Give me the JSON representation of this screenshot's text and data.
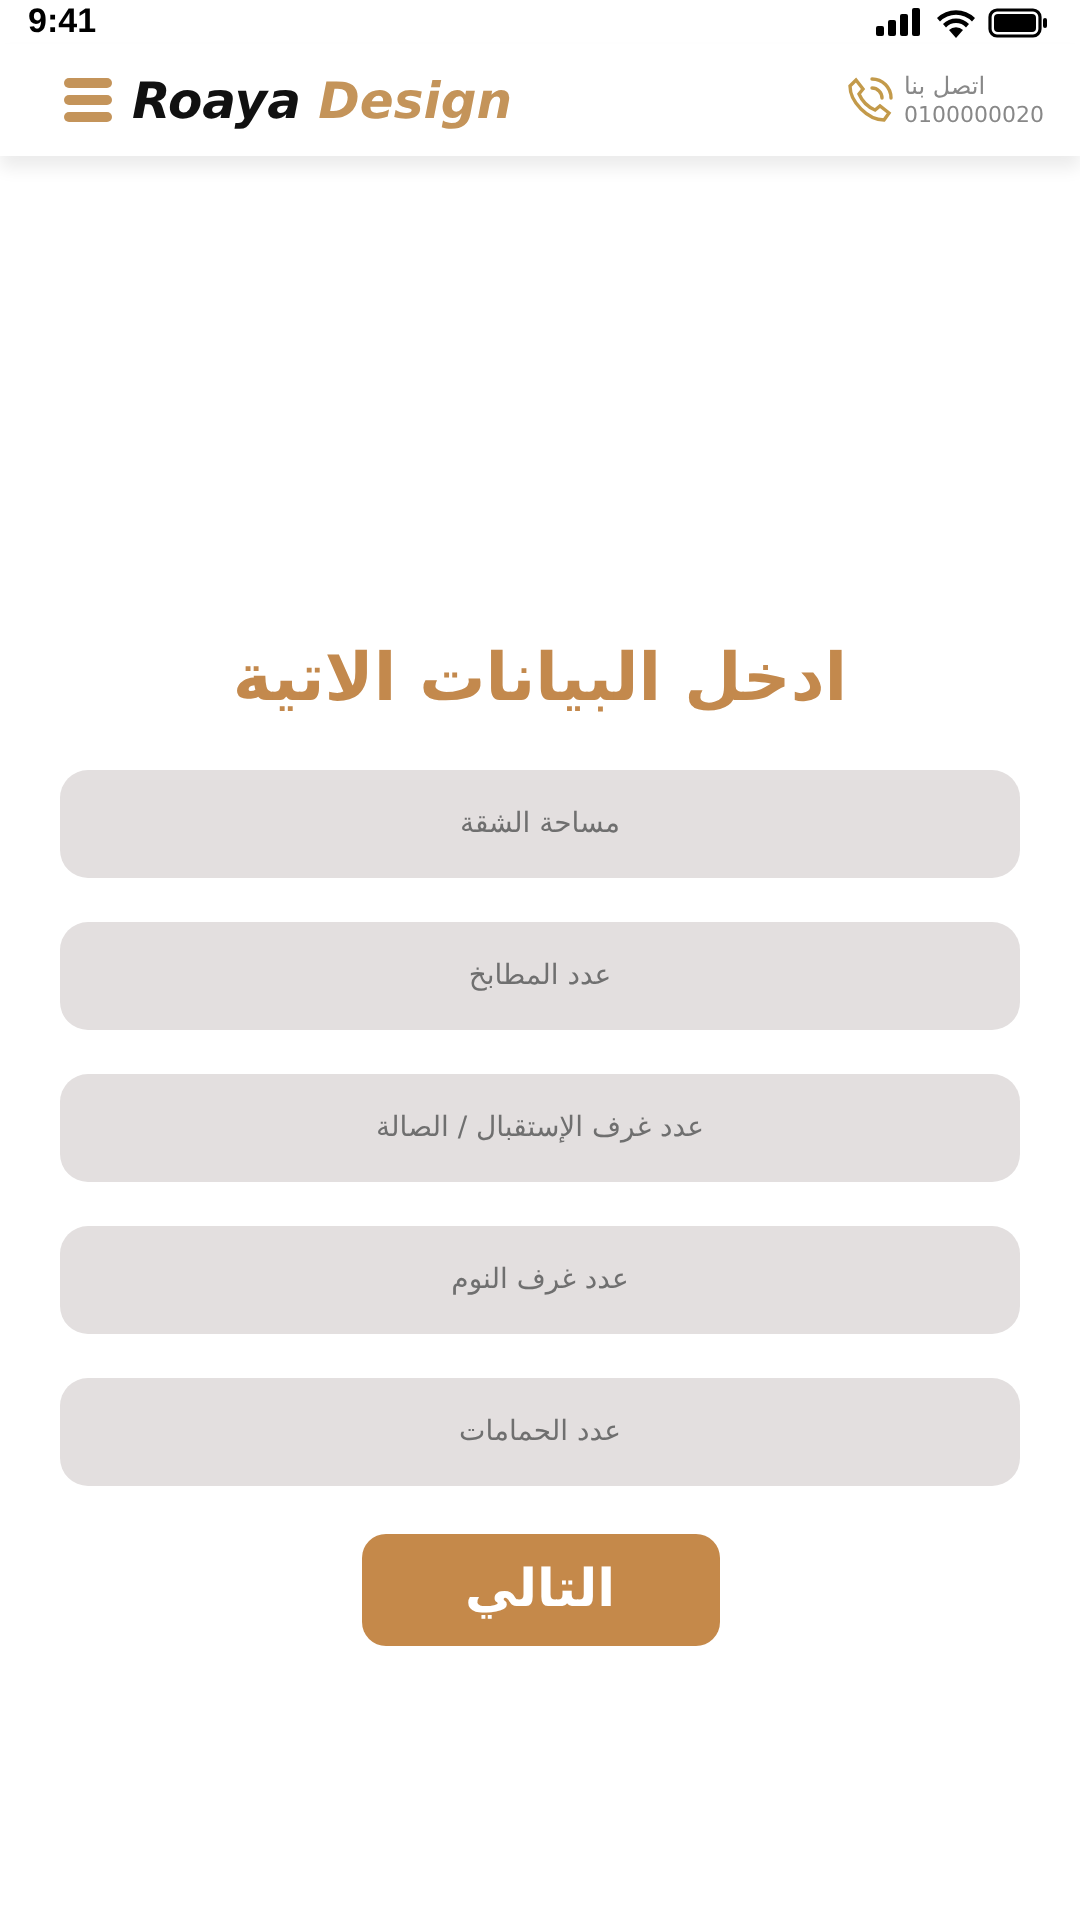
{
  "status_bar": {
    "time": "9:41"
  },
  "header": {
    "logo_part1": "Roaya",
    "logo_part2": "Design",
    "contact_label": "اتصل بنا",
    "contact_phone": "0100000020"
  },
  "title": "ادخل البيانات الاتية",
  "fields": [
    {
      "placeholder": "مساحة الشقة"
    },
    {
      "placeholder": "عدد المطابخ"
    },
    {
      "placeholder": "عدد غرف الإستقبال / الصالة"
    },
    {
      "placeholder": "عدد غرف النوم"
    },
    {
      "placeholder": "عدد الحمامات"
    }
  ],
  "next_button": "التالي"
}
